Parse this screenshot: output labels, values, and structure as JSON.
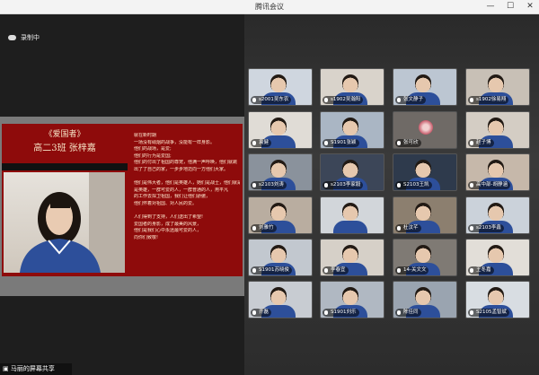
{
  "window": {
    "title": "腾讯会议",
    "minimize": "—",
    "maximize": "☐",
    "close": "✕"
  },
  "status": {
    "recording_label": "录制中"
  },
  "slide": {
    "title": "《爱国者》",
    "subtitle": "高二3班  张梓嘉",
    "poem": [
      "就在新时期",
      "一场没有硝烟的战争，没能有一样身影。",
      "他们的战场，是爱;",
      "他们的行为是爱国;",
      "他们的付出了祖国的尊宠，他满一声呼唤，他们就跳",
      "出了了自己的家，一步步地迈向一方他们大家。",
      "",
      "他们是伟大者，他们是英雄人，她们是战士，他们就是",
      "是英雄，一群可爱的人，一群普通的人，用平凡",
      "的工作去捍卫祖国，我们让他们骄傲，",
      "他们怀着对祖国、对人民的爱。",
      "",
      "人们得到了支持，人们送出了希望!",
      "爱国者的身影，成了最美的风景，",
      "他们是我们心中永远最可爱的人，",
      "向你们致敬!"
    ]
  },
  "share_bar": {
    "label": "马丽的屏幕共享"
  },
  "participants": [
    {
      "name": "s2001吴东农"
    },
    {
      "name": "s1902吴瀚阳"
    },
    {
      "name": "张文静子"
    },
    {
      "name": "s1902徐易翔"
    },
    {
      "name": "袁健"
    },
    {
      "name": "S1901张颖"
    },
    {
      "name": "张可欣"
    },
    {
      "name": "赵子博"
    },
    {
      "name": "s2103刘涛"
    },
    {
      "name": "s2103李家毅"
    },
    {
      "name": "S2103王凯"
    },
    {
      "name": "高中部-胡静涵"
    },
    {
      "name": "刘雅竹"
    },
    {
      "name": ""
    },
    {
      "name": "杜汶芊"
    },
    {
      "name": "s2103李鑫"
    },
    {
      "name": "S1901苏晓俊"
    },
    {
      "name": "李春宜"
    },
    {
      "name": "14-关文文"
    },
    {
      "name": "王冬嘉"
    },
    {
      "name": "齐磊"
    },
    {
      "name": "S1901刘乐"
    },
    {
      "name": "陈佳同"
    },
    {
      "name": "S2105孟智斌"
    }
  ],
  "colors": {
    "slide_red": "#8e0b0b",
    "uniform_blue": "#2d4f9a",
    "dark_bg": "#1e1e1e"
  }
}
